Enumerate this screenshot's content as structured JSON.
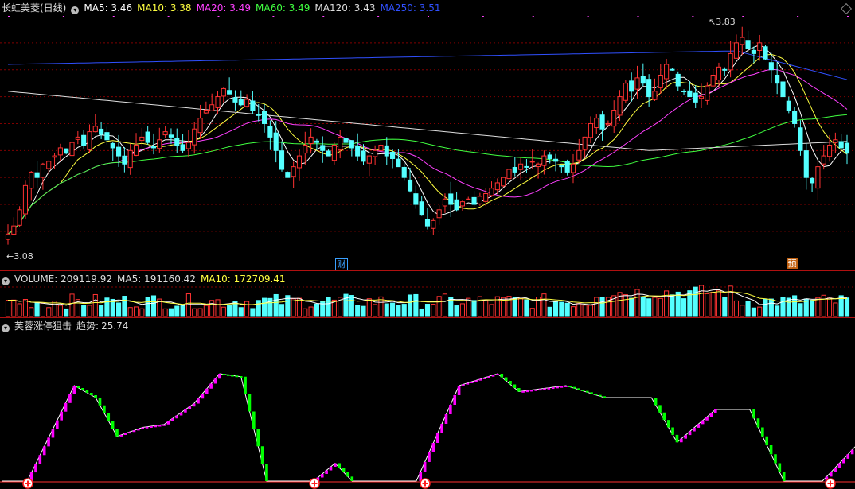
{
  "main_panel": {
    "title": "长虹美菱(日线)",
    "ma": [
      {
        "label": "MA5: 3.46",
        "color": "#ffffff"
      },
      {
        "label": "MA10: 3.38",
        "color": "#ffff40"
      },
      {
        "label": "MA20: 3.49",
        "color": "#ff40ff"
      },
      {
        "label": "MA60: 3.49",
        "color": "#40ff40"
      },
      {
        "label": "MA120: 3.43",
        "color": "#dddddd"
      },
      {
        "label": "MA250: 3.51",
        "color": "#3050ff"
      }
    ],
    "high_label": "3.83",
    "low_label": "3.08",
    "markers": [
      {
        "text": "财",
        "color": "#3aa0ff"
      },
      {
        "text": "预",
        "color": "#e07020"
      }
    ]
  },
  "volume_panel": {
    "title": "VOLUME: 209119.92",
    "ma5": "MA5: 191160.42",
    "ma10": "MA10: 172709.41"
  },
  "indicator_panel": {
    "title": "芙蓉涨停狙击",
    "trend_label": "趋势:",
    "trend_value": "25.74"
  },
  "colors": {
    "up": "#ff3232",
    "down": "#54ffff",
    "bg": "#000000",
    "grid": "#800000",
    "ind_up": "#ff00ff",
    "ind_down": "#00ff00"
  },
  "chart_data": {
    "type": "candlestick",
    "closes": [
      3.09,
      3.12,
      3.18,
      3.27,
      3.32,
      3.3,
      3.35,
      3.36,
      3.38,
      3.41,
      3.39,
      3.43,
      3.45,
      3.42,
      3.47,
      3.49,
      3.46,
      3.44,
      3.41,
      3.38,
      3.35,
      3.4,
      3.42,
      3.45,
      3.43,
      3.41,
      3.44,
      3.47,
      3.45,
      3.42,
      3.4,
      3.43,
      3.48,
      3.52,
      3.55,
      3.57,
      3.6,
      3.63,
      3.61,
      3.58,
      3.57,
      3.59,
      3.55,
      3.53,
      3.5,
      3.45,
      3.4,
      3.33,
      3.3,
      3.34,
      3.38,
      3.42,
      3.45,
      3.43,
      3.4,
      3.38,
      3.42,
      3.45,
      3.43,
      3.41,
      3.38,
      3.36,
      3.38,
      3.4,
      3.42,
      3.38,
      3.37,
      3.34,
      3.3,
      3.25,
      3.2,
      3.16,
      3.12,
      3.14,
      3.18,
      3.22,
      3.2,
      3.18,
      3.21,
      3.22,
      3.2,
      3.23,
      3.24,
      3.26,
      3.28,
      3.3,
      3.33,
      3.32,
      3.35,
      3.34,
      3.36,
      3.35,
      3.38,
      3.37,
      3.36,
      3.34,
      3.32,
      3.35,
      3.4,
      3.45,
      3.5,
      3.52,
      3.48,
      3.5,
      3.55,
      3.6,
      3.65,
      3.62,
      3.67,
      3.65,
      3.6,
      3.62,
      3.68,
      3.72,
      3.7,
      3.64,
      3.62,
      3.6,
      3.58,
      3.6,
      3.64,
      3.68,
      3.71,
      3.7,
      3.76,
      3.8,
      3.82,
      3.78,
      3.76,
      3.8,
      3.74,
      3.7,
      3.65,
      3.6,
      3.55,
      3.5,
      3.4,
      3.3,
      3.28,
      3.34,
      3.38,
      3.42,
      3.44,
      3.41,
      3.39
    ]
  }
}
